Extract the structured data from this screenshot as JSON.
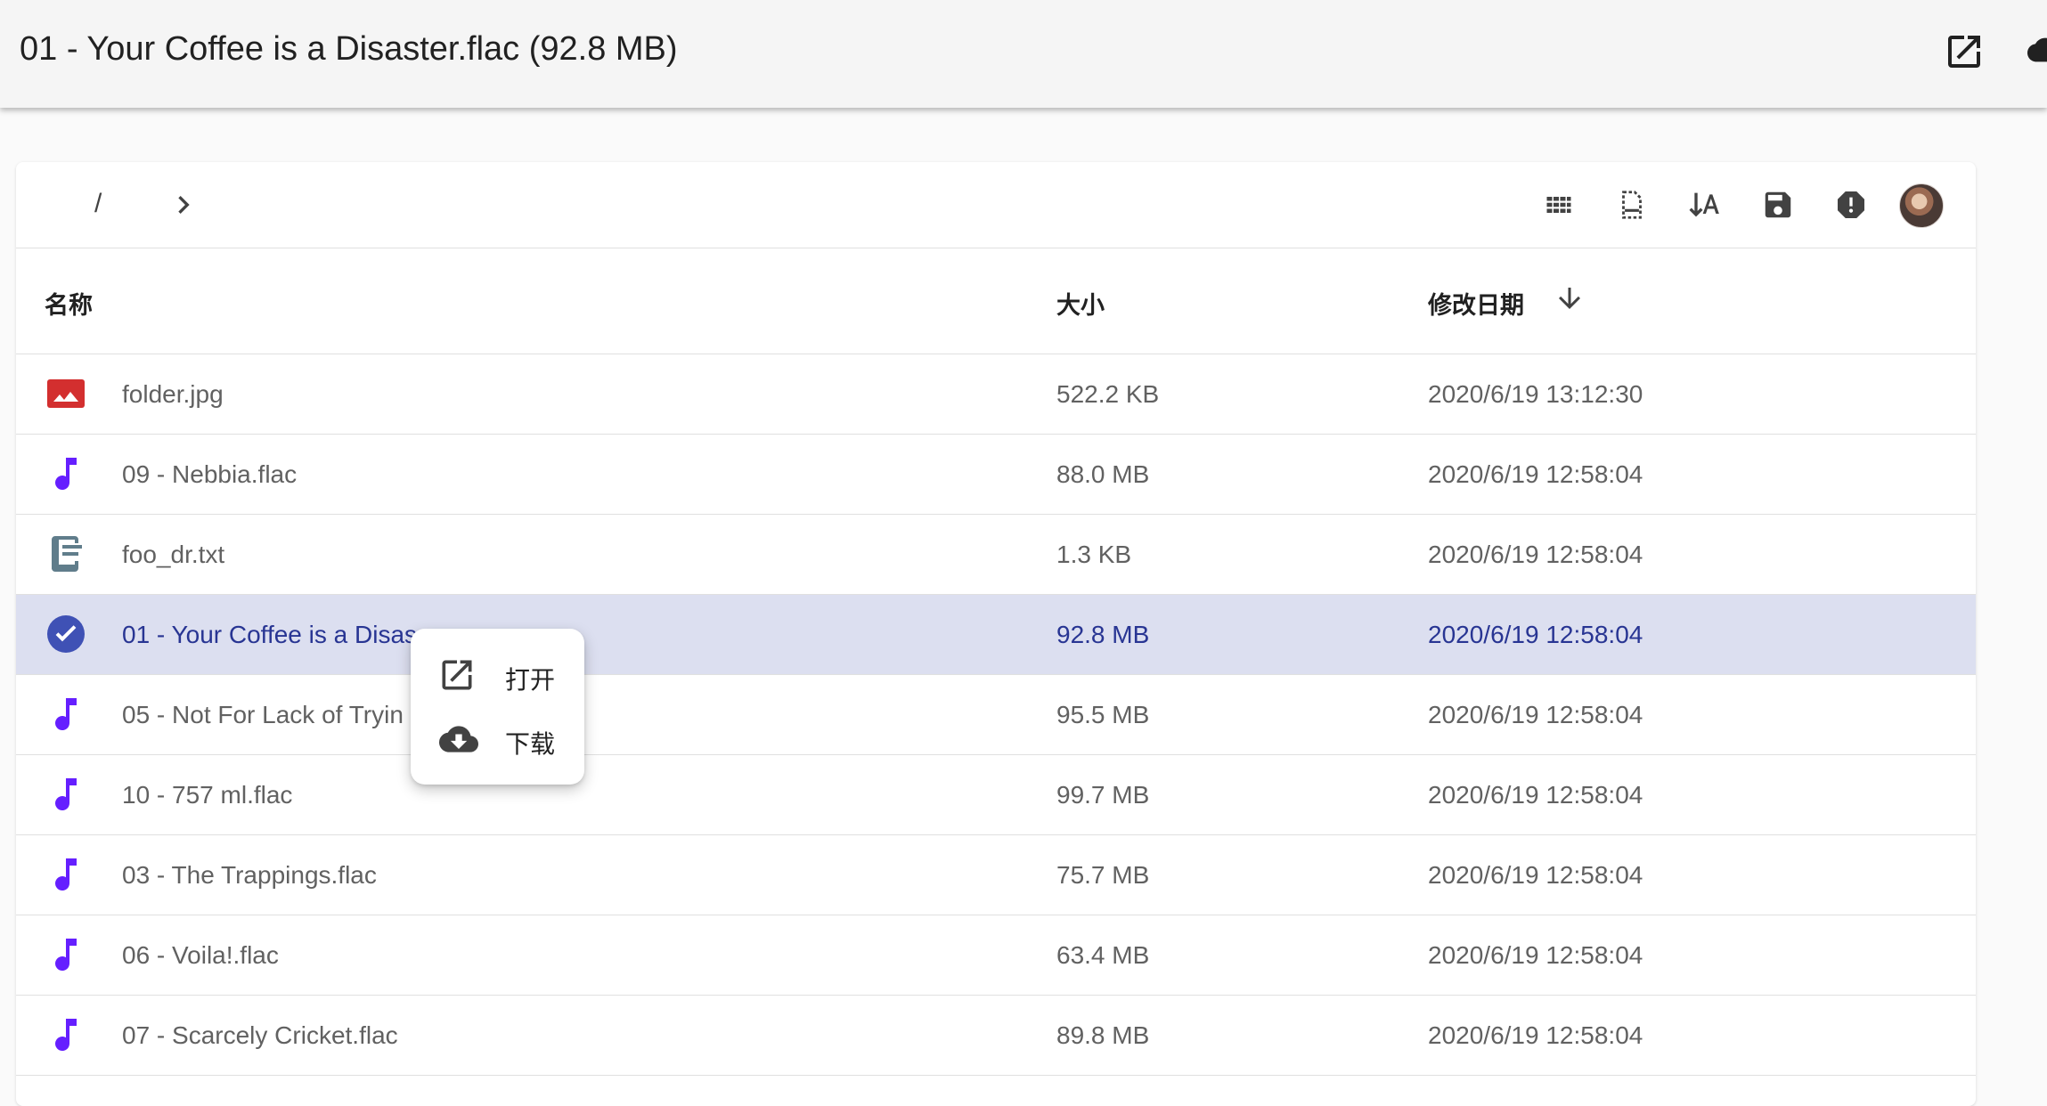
{
  "appbar": {
    "title": "01 - Your Coffee is a Disaster.flac (92.8 MB)",
    "open_icon": "open-in-new-icon",
    "download_icon": "cloud-download-icon"
  },
  "breadcrumb": {
    "separator": "/",
    "chevron_icon": "chevron-right-icon"
  },
  "toolbar": {
    "icons": [
      "grid-view-icon",
      "select-file-icon",
      "sort-by-alpha-icon",
      "save-icon",
      "report-icon",
      "avatar"
    ]
  },
  "table": {
    "headers": {
      "name": "名称",
      "size": "大小",
      "modified": "修改日期"
    },
    "sort_icon": "arrow-down-icon",
    "rows": [
      {
        "icon": "image-icon",
        "name": "folder.jpg",
        "size": "522.2 KB",
        "date": "2020/6/19 13:12:30",
        "selected": false
      },
      {
        "icon": "music-note-icon",
        "name": "09 - Nebbia.flac",
        "size": "88.0 MB",
        "date": "2020/6/19 12:58:04",
        "selected": false
      },
      {
        "icon": "text-file-icon",
        "name": "foo_dr.txt",
        "size": "1.3 KB",
        "date": "2020/6/19 12:58:04",
        "selected": false
      },
      {
        "icon": "check-circle-icon",
        "name": "01 - Your Coffee is a Disas",
        "size": "92.8 MB",
        "date": "2020/6/19 12:58:04",
        "selected": true
      },
      {
        "icon": "music-note-icon",
        "name": "05 - Not For Lack of Tryin",
        "size": "95.5 MB",
        "date": "2020/6/19 12:58:04",
        "selected": false
      },
      {
        "icon": "music-note-icon",
        "name": "10 - 757 ml.flac",
        "size": "99.7 MB",
        "date": "2020/6/19 12:58:04",
        "selected": false
      },
      {
        "icon": "music-note-icon",
        "name": "03 - The Trappings.flac",
        "size": "75.7 MB",
        "date": "2020/6/19 12:58:04",
        "selected": false
      },
      {
        "icon": "music-note-icon",
        "name": "06 - Voila!.flac",
        "size": "63.4 MB",
        "date": "2020/6/19 12:58:04",
        "selected": false
      },
      {
        "icon": "music-note-icon",
        "name": "07 - Scarcely Cricket.flac",
        "size": "89.8 MB",
        "date": "2020/6/19 12:58:04",
        "selected": false
      }
    ]
  },
  "context_menu": {
    "items": [
      {
        "icon": "open-in-new-icon",
        "label": "打开"
      },
      {
        "icon": "cloud-download-icon",
        "label": "下载"
      }
    ]
  },
  "colors": {
    "music_icon": "#651fff",
    "image_icon": "#d32f2f",
    "text_icon": "#607d8b",
    "selected_row": "#dcdff0",
    "selected_check": "#3f51b5",
    "selected_text": "#283593"
  }
}
